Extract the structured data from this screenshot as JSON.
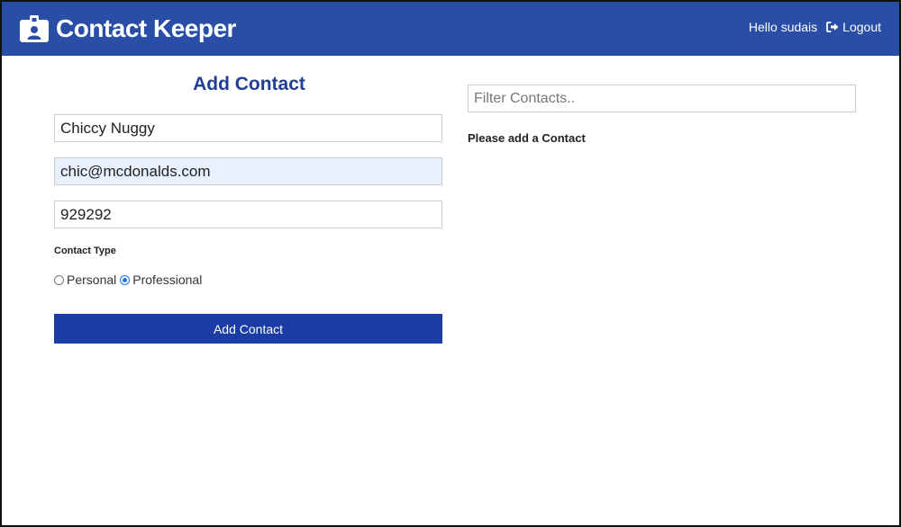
{
  "navbar": {
    "brand": "Contact Keeper",
    "brand_icon": "id-badge-icon",
    "greeting": "Hello sudais",
    "logout_label": "Logout",
    "logout_icon": "sign-out-icon",
    "bg_color": "#2a4ea6"
  },
  "form": {
    "title": "Add Contact",
    "name_value": "Chiccy Nuggy",
    "email_value": "chic@mcdonalds.com",
    "phone_value": "929292",
    "type_label": "Contact Type",
    "type_options": [
      {
        "label": "Personal",
        "checked": false
      },
      {
        "label": "Professional",
        "checked": true
      }
    ],
    "submit_label": "Add Contact",
    "accent_color": "#1b3da3"
  },
  "contacts": {
    "filter_placeholder": "Filter Contacts..",
    "empty_message": "Please add a Contact"
  }
}
